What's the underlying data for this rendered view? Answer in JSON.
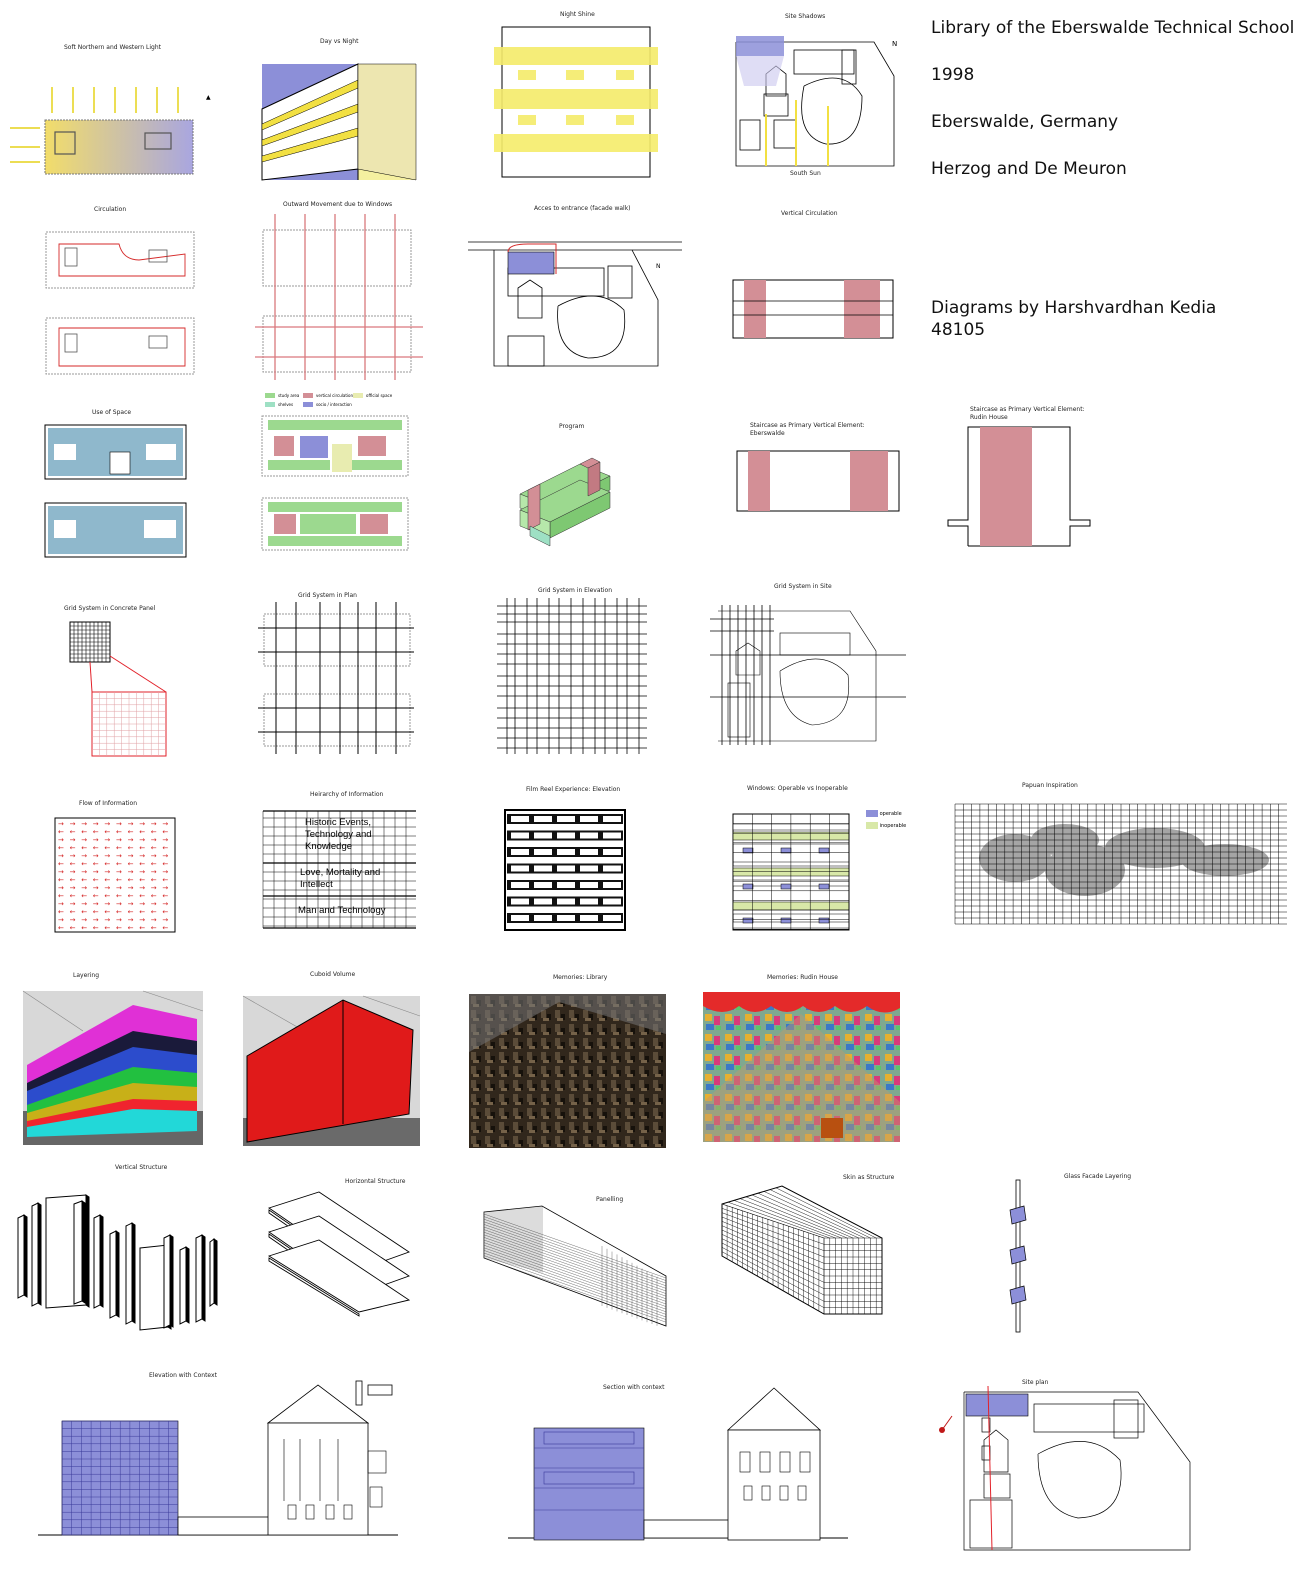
{
  "info": {
    "title": "Library of the Eberswalde Technical School",
    "year": "1998",
    "location": "Eberswalde, Germany",
    "architects": "Herzog and De Meuron",
    "credit_line1": "Diagrams by Harshvardhan Kedia",
    "credit_line2": "48105"
  },
  "captions": {
    "soft_light": "Soft Northern and Western Light",
    "day_night": "Day vs Night",
    "night_shine": "Night Shine",
    "site_shadows": "Site Shadows",
    "south_sun": "South Sun",
    "circulation": "Circulation",
    "outward_movement": "Outward Movement due to Windows",
    "access": "Acces to entrance (facade walk)",
    "vertical_circulation": "Vertical Circulation",
    "use_of_space": "Use of Space",
    "program": "Program",
    "staircase_eberswalde_1": "Staircase as Primary Vertical Element:",
    "staircase_eberswalde_2": "Eberswalde",
    "staircase_rudin_1": "Staircase as Primary Vertical Element:",
    "staircase_rudin_2": "Rudin House",
    "grid_panel": "Grid System in Concrete Panel",
    "grid_plan": "Grid System in Plan",
    "grid_elevation": "Grid System in Elevation",
    "grid_site": "Grid System in Site",
    "flow_info": "Flow of Information",
    "hierarchy": "Heirarchy of Information",
    "film_reel": "Film Reel Experience: Elevation",
    "windows": "Windows: Operable vs Inoperable",
    "papuan": "Papuan Inspiration",
    "layering": "Layering",
    "cuboid": "Cuboid Volume",
    "mem_library": "Memories: Library",
    "mem_rudin": "Memories: Rudin House",
    "vertical_structure": "Vertical Structure",
    "horizontal_structure": "Horizontal Structure",
    "panelling": "Panelling",
    "skin": "Skin as Structure",
    "glass_facade": "Glass Facade Layering",
    "elev_context": "Elevation with Context",
    "section_context": "Section with context",
    "site_plan": "Site plan"
  },
  "legend_use": {
    "study": "study area",
    "vert": "vertical circulation",
    "official": "official space",
    "shelves": "shelves",
    "socio": "socio / interaction"
  },
  "hierarchy_labels": [
    "Historic Events, Technology and Knowledge",
    "Love, Mortality and Intellect",
    "Man and Technology"
  ],
  "window_legend": {
    "operable": "operable",
    "inoperable": "inoperable"
  },
  "north_label": "N",
  "colors": {
    "yellow": "#f5ec6a",
    "blue": "#8c8fd8",
    "pink": "#d38f96",
    "lightblue": "#8fb8cc",
    "green": "#9cd98f",
    "red": "#e2222a",
    "green_light": "#d8e8a8"
  }
}
